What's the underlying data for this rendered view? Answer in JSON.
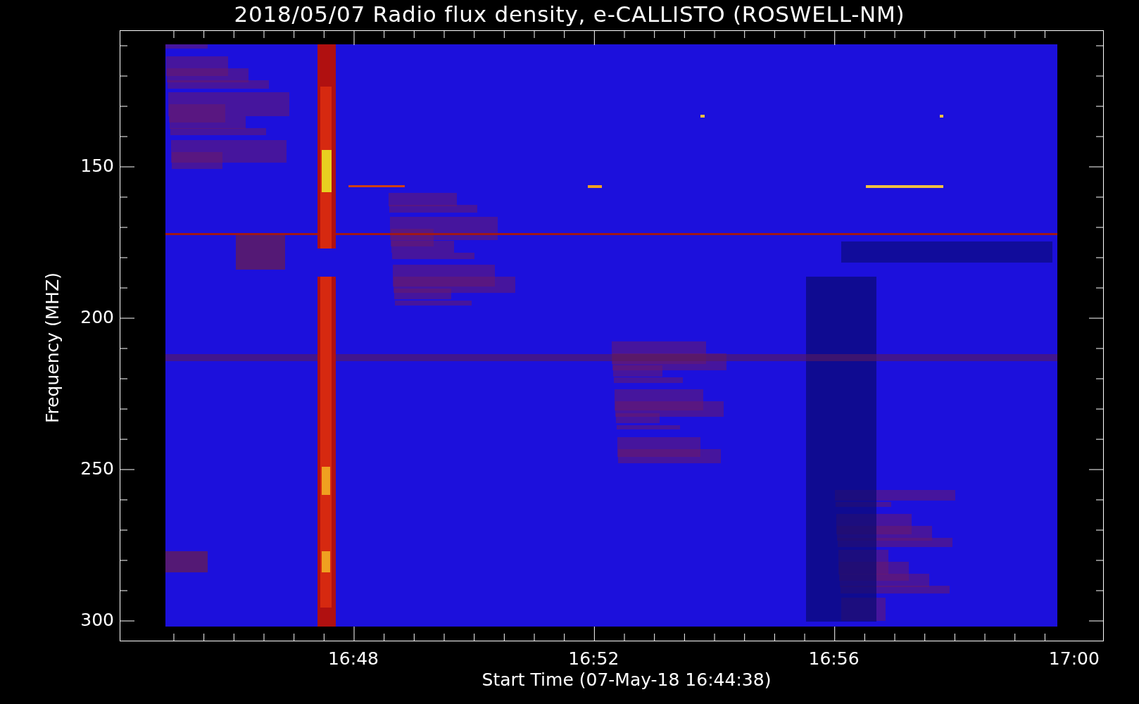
{
  "title": "2018/05/07  Radio flux density, e-CALLISTO (ROSWELL-NM)",
  "y_axis": {
    "label": "Frequency (MHZ)",
    "ticks": [
      "150",
      "200",
      "250",
      "300"
    ]
  },
  "x_axis": {
    "label": "Start Time (07-May-18 16:44:38)",
    "ticks": [
      "16:48",
      "16:52",
      "16:56",
      "17:00"
    ]
  }
}
